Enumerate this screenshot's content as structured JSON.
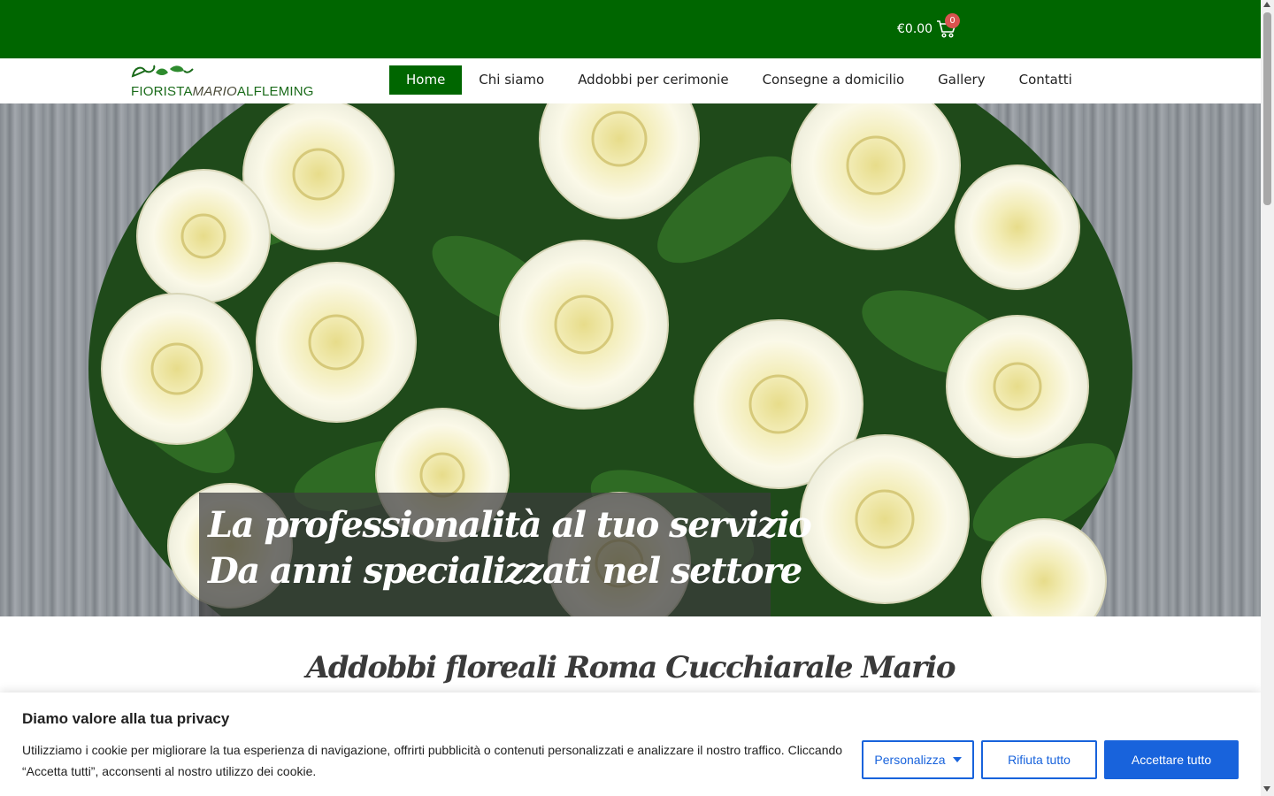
{
  "topbar": {
    "cart_amount": "€0.00",
    "cart_count": "0"
  },
  "logo": {
    "part1": "FIORISTA",
    "part2": "MARIO",
    "part3": "ALFLEMING"
  },
  "nav": {
    "items": [
      {
        "label": "Home",
        "active": true
      },
      {
        "label": "Chi siamo"
      },
      {
        "label": "Addobbi per cerimonie"
      },
      {
        "label": "Consegne a domicilio"
      },
      {
        "label": "Gallery"
      },
      {
        "label": "Contatti"
      }
    ]
  },
  "hero": {
    "line1": "La professionalità al tuo servizio",
    "line2": "Da anni specializzati nel settore"
  },
  "section": {
    "title": "Addobbi floreali Roma Cucchiarale Mario"
  },
  "cookie": {
    "title": "Diamo valore alla tua privacy",
    "text": "Utilizziamo i cookie per migliorare la tua esperienza di navigazione, offrirti pubblicità o contenuti personalizzati e analizzare il nostro traffico. Cliccando “Accetta tutti”, acconsenti al nostro utilizzo dei cookie.",
    "customize_label": "Personalizza",
    "reject_label": "Rifiuta tutto",
    "accept_label": "Accettare tutto"
  },
  "colors": {
    "brand_green": "#006600",
    "accent_blue": "#1863dc",
    "badge_red": "#d9534f"
  }
}
